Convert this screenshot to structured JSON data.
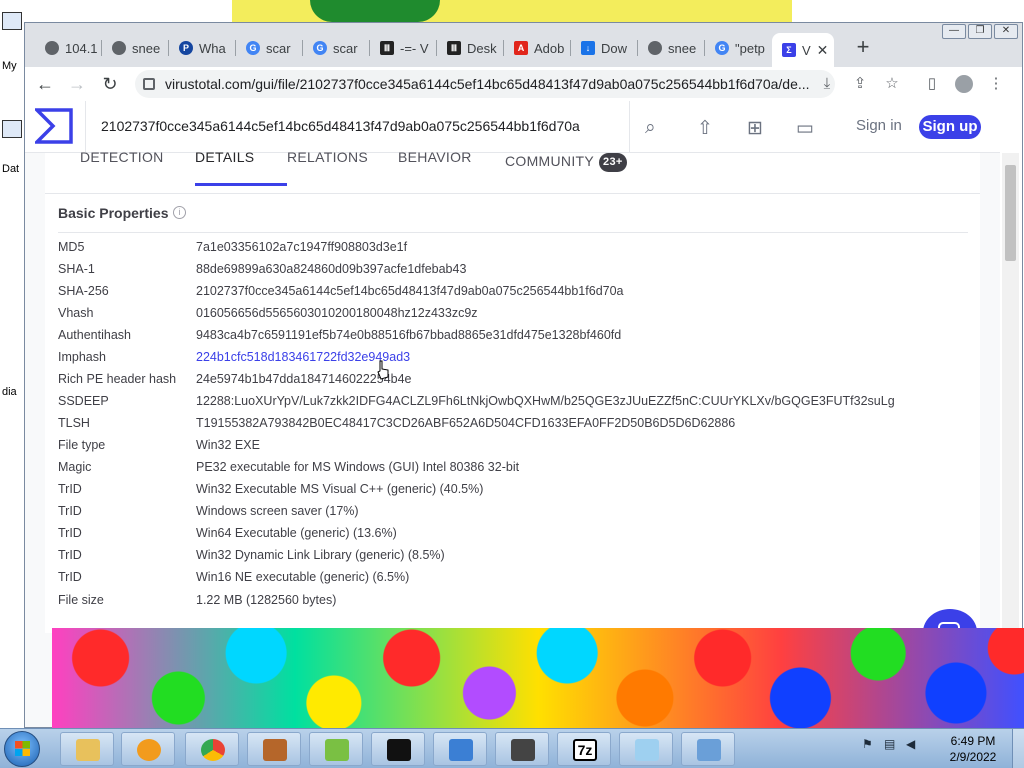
{
  "desktop": {
    "left_labels": [
      "My",
      "Dat",
      "dia"
    ],
    "colors": {
      "band_red": "#ff2a2a",
      "band_blue": "#1040ff",
      "band_cyan": "#00d7ff"
    }
  },
  "browser": {
    "window_controls": {
      "minimize": "—",
      "restore": "❐",
      "close": "✕"
    },
    "tabs": [
      {
        "label": "104.1",
        "icon": "globe-icon"
      },
      {
        "label": "snee",
        "icon": "globe-icon"
      },
      {
        "label": "Wha",
        "icon": "paypal-icon"
      },
      {
        "label": "scar",
        "icon": "google-icon"
      },
      {
        "label": "scar",
        "icon": "google-icon"
      },
      {
        "label": "-=- V",
        "icon": "museum-icon"
      },
      {
        "label": "Desk",
        "icon": "museum-icon"
      },
      {
        "label": "Adob",
        "icon": "adobe-icon"
      },
      {
        "label": "Dow",
        "icon": "download-icon"
      },
      {
        "label": "snee",
        "icon": "globe-icon"
      },
      {
        "label": "\"petp",
        "icon": "google-icon"
      },
      {
        "label": "V",
        "icon": "virustotal-icon",
        "active": true
      }
    ],
    "new_tab": "+",
    "url": "virustotal.com/gui/file/2102737f0cce345a6144c5ef14bc65d48413f47d9ab0a075c256544bb1f6d70a/de..."
  },
  "vt": {
    "search_value": "2102737f0cce345a6144c5ef14bc65d48413f47d9ab0a075c256544bb1f6d70a",
    "sign_in": "Sign in",
    "sign_up": "Sign up",
    "tabs": {
      "detection": "DETECTION",
      "details": "DETAILS",
      "relations": "RELATIONS",
      "behavior": "BEHAVIOR",
      "community": "COMMUNITY",
      "community_badge": "23+"
    },
    "section_title": "Basic Properties",
    "properties": [
      {
        "key": "MD5",
        "value": "7a1e03356102a7c1947ff908803d3e1f"
      },
      {
        "key": "SHA-1",
        "value": "88de69899a630a824860d09b397acfe1dfebab43"
      },
      {
        "key": "SHA-256",
        "value": "2102737f0cce345a6144c5ef14bc65d48413f47d9ab0a075c256544bb1f6d70a"
      },
      {
        "key": "Vhash",
        "value": "016056656d5565603010200180048hz12z433zc9z"
      },
      {
        "key": "Authentihash",
        "value": "9483ca4b7c6591191ef5b74e0b88516fb67bbad8865e31dfd475e1328bf460fd"
      },
      {
        "key": "Imphash",
        "value": "224b1cfc518d183461722fd32e949ad3"
      },
      {
        "key": "Rich PE header hash",
        "value": "24e5974b1b47dda1847146022254b4e"
      },
      {
        "key": "SSDEEP",
        "value": "12288:LuoXUrYpV/Luk7zkk2IDFG4ACLZL9Fh6LtNkjOwbQXHwM/b25QGE3zJUuEZZf5nC:CUUrYKLXv/bGQGE3FUTf32suLg"
      },
      {
        "key": "TLSH",
        "value": "T19155382A793842B0EC48417C3CD26ABF652A6D504CFD1633EFA0FF2D50B6D5D6D62886"
      },
      {
        "key": "File type",
        "value": "Win32 EXE"
      },
      {
        "key": "Magic",
        "value": "PE32 executable for MS Windows (GUI) Intel 80386 32-bit"
      },
      {
        "key": "TrID",
        "value": "Win32 Executable MS Visual C++ (generic) (40.5%)"
      },
      {
        "key": "TrID",
        "value": "Windows screen saver (17%)"
      },
      {
        "key": "TrID",
        "value": "Win64 Executable (generic) (13.6%)"
      },
      {
        "key": "TrID",
        "value": "Win32 Dynamic Link Library (generic) (8.5%)"
      },
      {
        "key": "TrID",
        "value": "Win16 NE executable (generic) (6.5%)"
      },
      {
        "key": "File size",
        "value": "1.22 MB (1282560 bytes)"
      }
    ],
    "colors": {
      "accent": "#3b40e8",
      "text": "#3f3f46"
    }
  },
  "taskbar": {
    "time": "6:49 PM",
    "date": "2/9/2022",
    "apps": [
      "explorer-icon",
      "media-player-icon",
      "chrome-icon",
      "app-icon",
      "notepad-plus-icon",
      "cmd-icon",
      "security-icon",
      "tool-icon",
      "7zip-icon",
      "notepad-icon",
      "control-panel-icon"
    ],
    "app_7z_label": "7z"
  }
}
